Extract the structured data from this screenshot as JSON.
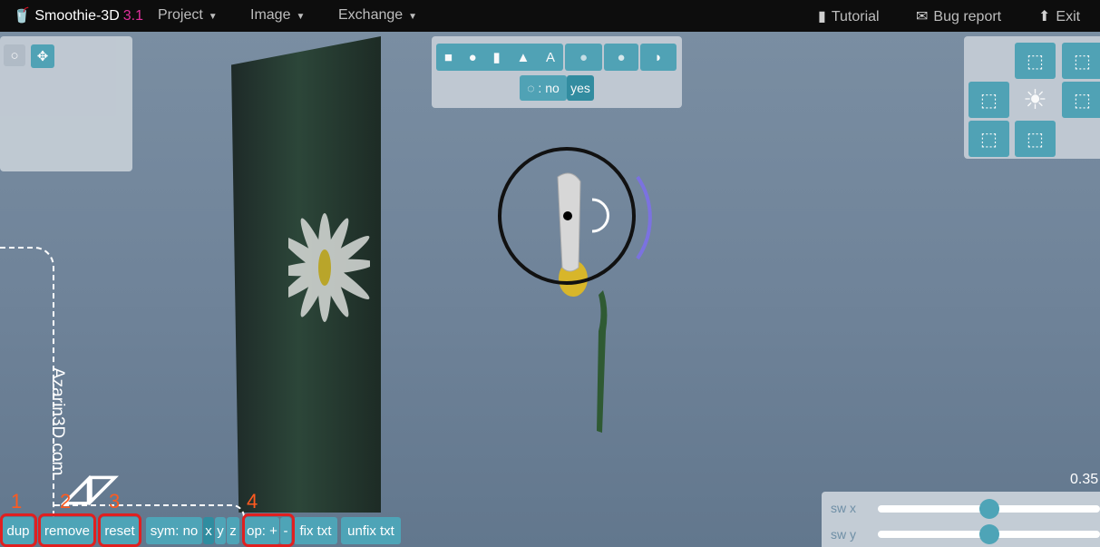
{
  "app": {
    "title": "Smoothie-3D",
    "version": "3.1"
  },
  "menu": {
    "project": "Project",
    "image": "Image",
    "exchange": "Exchange"
  },
  "menu_right": {
    "tutorial": "Tutorial",
    "bug_report": "Bug report",
    "exit": "Exit"
  },
  "top_toolbar": {
    "symbol_toggle_label": "◌ : no",
    "symbol_toggle_yes": "yes",
    "text_shape": "A"
  },
  "watermark": {
    "text": "Azarin3D.com"
  },
  "bottom_toolbar": {
    "dup": "dup",
    "remove": "remove",
    "reset": "reset",
    "sym_label": "sym: no",
    "sym_x": "x",
    "sym_y": "y",
    "sym_z": "z",
    "op_label": "op: +",
    "op_minus": "-",
    "fix_txt": "fix txt",
    "unfix_txt": "unfix txt"
  },
  "annotations": {
    "n1": "1",
    "n2": "2",
    "n3": "3",
    "n4": "4"
  },
  "value_readout": "0.35",
  "sliders": {
    "sw_x_label": "sw x",
    "sw_y_label": "sw y",
    "sw_x_level": 0.5,
    "sw_y_level": 0.5
  }
}
